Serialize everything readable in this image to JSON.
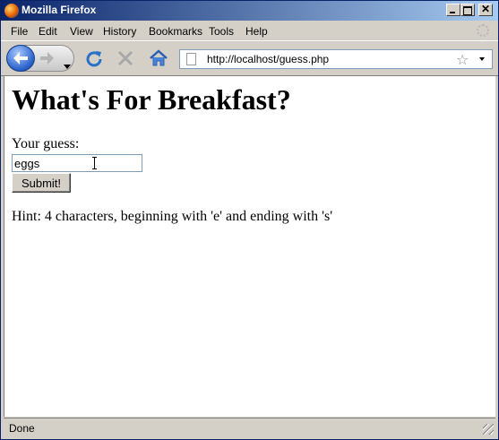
{
  "window": {
    "title": "Mozilla Firefox"
  },
  "menu": [
    {
      "label": "File",
      "id": "file"
    },
    {
      "label": "Edit",
      "id": "edit"
    },
    {
      "label": "View",
      "id": "view"
    },
    {
      "label": "History",
      "id": "history"
    },
    {
      "label": "Bookmarks",
      "id": "bookmarks"
    },
    {
      "label": "Tools",
      "id": "tools"
    },
    {
      "label": "Help",
      "id": "help"
    }
  ],
  "toolbar": {
    "url": "http://localhost/guess.php"
  },
  "page": {
    "heading": "What's For Breakfast?",
    "guess_label": "Your guess:",
    "guess_value": "eggs",
    "submit_label": "Submit!",
    "hint": "Hint: 4 characters, beginning with 'e' and ending with 's'"
  },
  "status": {
    "text": "Done"
  },
  "colors": {
    "titlebar": "#0a246a",
    "chrome": "#d4d0c8",
    "back_button": "#2860c8"
  }
}
